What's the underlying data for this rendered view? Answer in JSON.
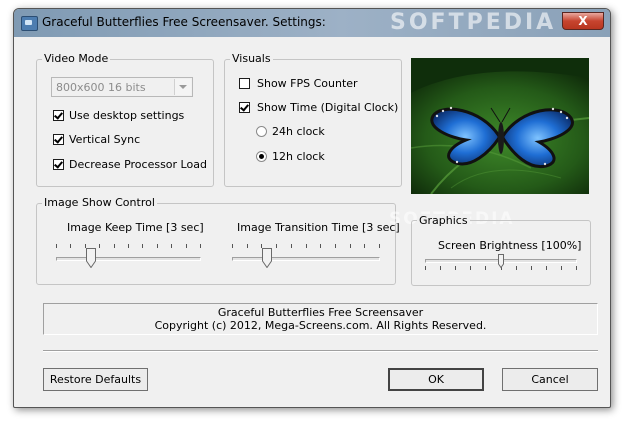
{
  "window": {
    "title": "Graceful Butterflies Free Screensaver. Settings:",
    "close_glyph": "X"
  },
  "video_mode": {
    "legend": "Video Mode",
    "resolution": "800x600 16 bits",
    "options": [
      {
        "label": "Use desktop settings",
        "checked": true
      },
      {
        "label": "Vertical Sync",
        "checked": true
      },
      {
        "label": "Decrease Processor Load",
        "checked": true
      }
    ]
  },
  "visuals": {
    "legend": "Visuals",
    "show_fps": {
      "label": "Show FPS Counter",
      "checked": false
    },
    "show_time": {
      "label": "Show Time (Digital Clock)",
      "checked": true
    },
    "clock_24h": {
      "label": "24h clock",
      "selected": false
    },
    "clock_12h": {
      "label": "12h clock",
      "selected": true
    }
  },
  "image_show": {
    "legend": "Image Show Control",
    "keep_time": {
      "label": "Image Keep Time [3 sec]",
      "value_fraction": 0.22
    },
    "transition_time": {
      "label": "Image Transition Time [3 sec]",
      "value_fraction": 0.22
    }
  },
  "graphics": {
    "legend": "Graphics",
    "brightness": {
      "label": "Screen Brightness [100%]",
      "value_fraction": 0.5
    }
  },
  "info": {
    "line1": "Graceful Butterflies Free Screensaver",
    "line2": "Copyright (c) 2012, Mega-Screens.com. All Rights Reserved."
  },
  "buttons": {
    "restore": "Restore Defaults",
    "ok": "OK",
    "cancel": "Cancel"
  },
  "watermark": "SOFTPEDIA",
  "icons": [
    "app-icon",
    "close-icon",
    "dropdown-arrow-icon",
    "butterfly-preview-image"
  ],
  "colors": {
    "title_bar": "#8fa6bd",
    "dialog_bg": "#f0f0f0",
    "close_button": "#c7442f",
    "butterfly_blue": "#1f6ed4"
  }
}
